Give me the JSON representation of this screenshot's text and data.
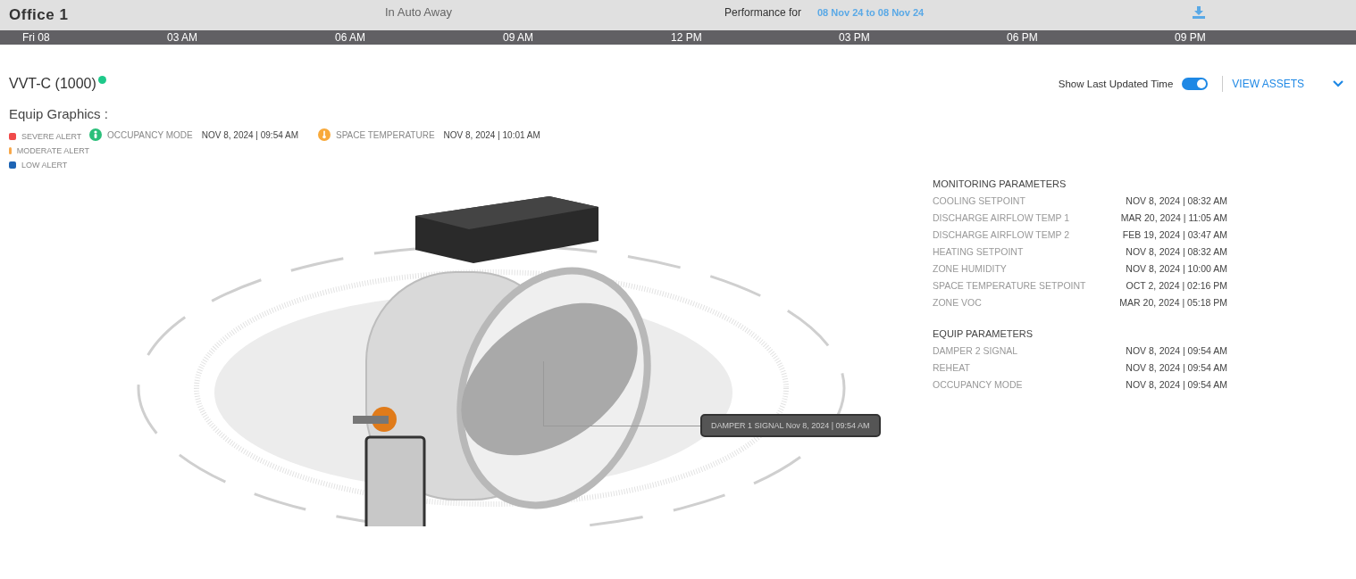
{
  "header": {
    "title": "Office 1",
    "mode": "In Auto Away",
    "performance_label": "Performance for",
    "date_range": "08 Nov 24 to 08 Nov 24"
  },
  "timeline": [
    "Fri 08",
    "03 AM",
    "06 AM",
    "09 AM",
    "12 PM",
    "03 PM",
    "06 PM",
    "09 PM"
  ],
  "equipment": {
    "name": "VVT-C (1000)",
    "online": true,
    "section_label": "Equip Graphics :"
  },
  "toolbar": {
    "toggle_label": "Show Last Updated Time",
    "toggle_on": true,
    "link": "VIEW ASSETS",
    "expanded": false
  },
  "alert_legend": [
    {
      "label": "SEVERE ALERT",
      "color": "#f04a4a"
    },
    {
      "label": "MODERATE ALERT",
      "color": "#f8a84a"
    },
    {
      "label": "LOW ALERT",
      "color": "#1e64b4"
    }
  ],
  "point_badges": [
    {
      "kind": "person",
      "label": "OCCUPANCY MODE",
      "time": "NOV 8, 2024 | 09:54 AM",
      "color": "#2bbf7a"
    },
    {
      "kind": "thermometer",
      "label": "SPACE TEMPERATURE",
      "time": "NOV 8, 2024 | 10:01 AM",
      "color": "#f8a93a"
    }
  ],
  "parameter_groups": [
    {
      "title": "MONITORING PARAMETERS",
      "items": [
        {
          "name": "COOLING SETPOINT",
          "time": "NOV 8, 2024 | 08:32 AM"
        },
        {
          "name": "DISCHARGE AIRFLOW TEMP 1",
          "time": "MAR 20, 2024 | 11:05 AM"
        },
        {
          "name": "DISCHARGE AIRFLOW TEMP 2",
          "time": "FEB 19, 2024 | 03:47 AM"
        },
        {
          "name": "HEATING SETPOINT",
          "time": "NOV 8, 2024 | 08:32 AM"
        },
        {
          "name": "ZONE HUMIDITY",
          "time": "NOV 8, 2024 | 10:00 AM"
        },
        {
          "name": "SPACE TEMPERATURE SETPOINT",
          "time": "OCT 2, 2024 | 02:16 PM"
        },
        {
          "name": "ZONE VOC",
          "time": "MAR 20, 2024 | 05:18 PM"
        }
      ]
    },
    {
      "title": "EQUIP PARAMETERS",
      "items": [
        {
          "name": "DAMPER 2 SIGNAL",
          "time": "NOV 8, 2024 | 09:54 AM"
        },
        {
          "name": "REHEAT",
          "time": "NOV 8, 2024 | 09:54 AM"
        },
        {
          "name": "OCCUPANCY MODE",
          "time": "NOV 8, 2024 | 09:54 AM"
        }
      ]
    }
  ],
  "graphic_tooltip": "DAMPER 1 SIGNAL Nov 8, 2024 | 09:54 AM"
}
